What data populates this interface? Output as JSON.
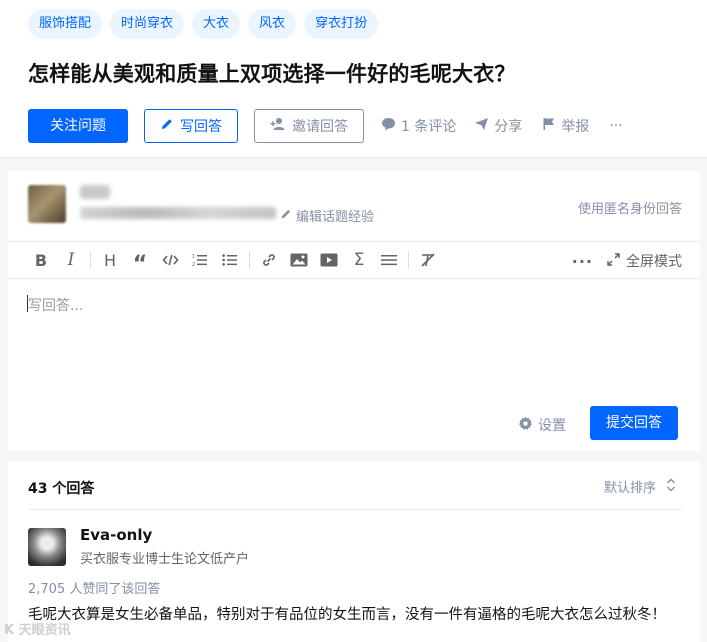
{
  "tags": [
    "服饰搭配",
    "时尚穿衣",
    "大衣",
    "风衣",
    "穿衣打扮"
  ],
  "question": {
    "title": "怎样能从美观和质量上双项选择一件好的毛呢大衣？"
  },
  "actions": {
    "follow": "关注问题",
    "write": "写回答",
    "invite": "邀请回答",
    "comments": "1 条评论",
    "share": "分享",
    "report": "举报",
    "more": "···"
  },
  "editor": {
    "edit_experience": "编辑话题经验",
    "anonymous": "使用匿名身份回答",
    "fullscreen": "全屏模式",
    "placeholder": "写回答...",
    "settings": "设置",
    "submit": "提交回答"
  },
  "answers": {
    "count_label": "43 个回答",
    "sort_label": "默认排序",
    "first": {
      "author": "Eva-only",
      "bio": "买衣服专业博士生论文低产户",
      "votes": "2,705 人赞同了该回答",
      "content": "毛呢大衣算是女生必备单品，特别对于有品位的女生而言，没有一件有逼格的毛呢大衣怎么过秋冬！"
    }
  },
  "watermark": "K 天眼资讯"
}
